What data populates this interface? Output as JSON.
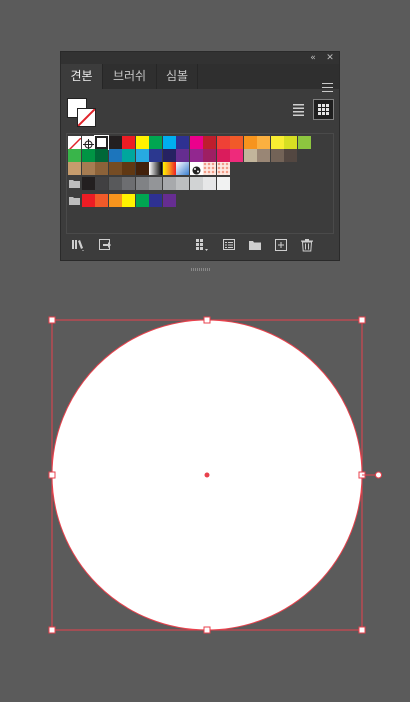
{
  "panel": {
    "collapse_icon": "double-chevron-icon",
    "close_icon": "close-icon",
    "menu_icon": "hamburger-menu-icon",
    "tabs": [
      {
        "label": "견본",
        "active": true
      },
      {
        "label": "브러쉬",
        "active": false
      },
      {
        "label": "심볼",
        "active": false
      }
    ],
    "view_modes": {
      "list": "list-view-icon",
      "grid": "grid-view-icon",
      "selected": "grid"
    },
    "swatch_rows": [
      [
        "none",
        "registration",
        "white-black",
        "#231f20",
        "#ed1c24",
        "#fff200",
        "#00a651",
        "#00aeef",
        "#2e3192",
        "#ec008c",
        "#be1e2d",
        "#ef4136",
        "#f15a29",
        "#f7941d",
        "#fbb040",
        "#f9ed32",
        "#d7df23",
        "#8dc63f"
      ],
      [
        "#39b54a",
        "#009444",
        "#006838",
        "#1c75bc",
        "#00a79d",
        "#27aae1",
        "#2b388f",
        "#262262",
        "#652d90",
        "#92278f",
        "#9e1f63",
        "#da1c5c",
        "#ee2a7b",
        "#c2b59b",
        "#998675",
        "#736357",
        "#534741"
      ],
      [
        "#c69c6d",
        "#a67c52",
        "#8c6239",
        "#754c24",
        "#603813",
        "#42210b",
        "gradient-white-black",
        "gradient-orange",
        "gradient-blue",
        "pattern-dots",
        "pattern-pink1",
        "pattern-pink2"
      ],
      [
        "folder",
        "#231f20",
        "#414042",
        "#58595b",
        "#6d6e71",
        "#808285",
        "#939598",
        "#a7a9ac",
        "#bcbec0",
        "#d1d3d4",
        "#e6e7e8",
        "#f1f2f2"
      ],
      [
        "folder",
        "#ed1c24",
        "#f15a29",
        "#f7941d",
        "#fff200",
        "#00a651",
        "#2e3192",
        "#662d91"
      ]
    ],
    "bottom_left_icons": [
      "swatch-libraries-icon",
      "import-swatches-icon"
    ],
    "bottom_right_icons": [
      "swatch-kinds-icon",
      "swatch-options-icon",
      "new-color-group-icon",
      "new-swatch-icon",
      "delete-swatch-icon"
    ]
  },
  "canvas": {
    "shape": "circle",
    "fill": "#ffffff",
    "stroke": "#e8414c",
    "selection_color": "#e8414c"
  }
}
